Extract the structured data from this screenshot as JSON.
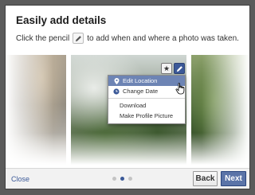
{
  "dialog": {
    "title": "Easily add details",
    "subtitle_before": "Click the pencil",
    "subtitle_after": "to add when and where a photo was taken."
  },
  "icons": {
    "pencil": "pencil-icon",
    "star": "star-icon",
    "location": "map-pin-icon",
    "date": "clock-icon",
    "cursor": "hand-pointer-icon"
  },
  "photo_menu": {
    "star_glyph": "★",
    "items": [
      {
        "label": "Edit Location",
        "active": true
      },
      {
        "label": "Change Date",
        "active": false
      },
      {
        "label": "Download",
        "active": false
      },
      {
        "label": "Make Profile Picture",
        "active": false
      }
    ]
  },
  "footer": {
    "close_label": "Close",
    "back_label": "Back",
    "next_label": "Next",
    "pagination": {
      "total": 3,
      "current": 2
    }
  },
  "colors": {
    "brand": "#3b5998",
    "menu_highlight": "#6d84b4",
    "overlay": "#5b5b5b"
  }
}
